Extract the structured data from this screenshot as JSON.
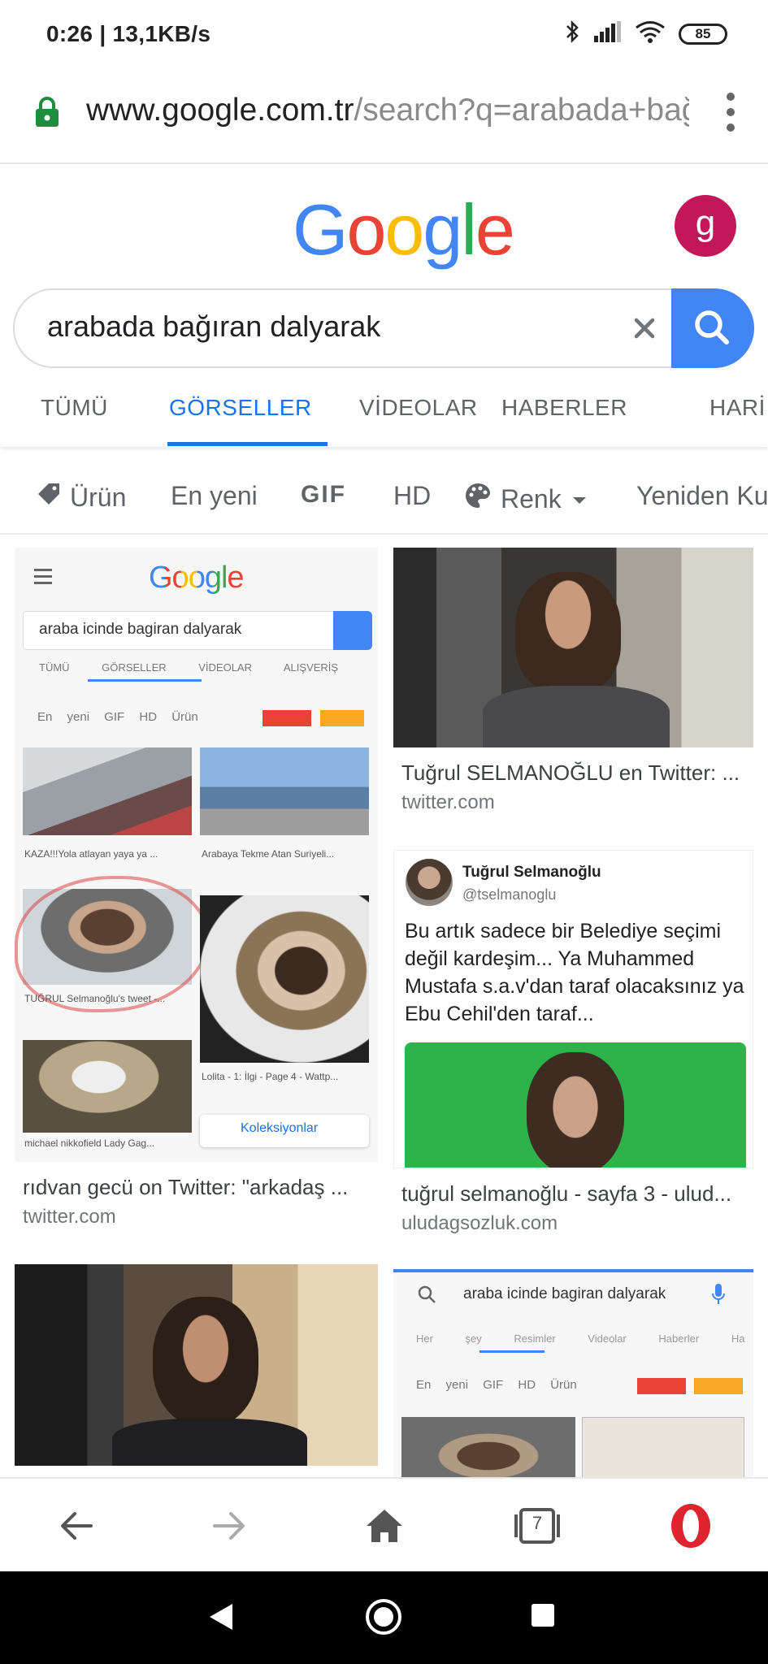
{
  "status_bar": {
    "time_speed": "0:26 | 13,1KB/s",
    "battery": "85"
  },
  "url_bar": {
    "domain": "www.google.com.tr",
    "path": "/search?q=arabada+bağ"
  },
  "header": {
    "logo_letters": [
      "G",
      "o",
      "o",
      "g",
      "l",
      "e"
    ],
    "logo_colors": [
      "#4285F4",
      "#EA4335",
      "#FBBC05",
      "#4285F4",
      "#34A853",
      "#EA4335"
    ],
    "avatar_letter": "g"
  },
  "search": {
    "query": "arabada bağıran dalyarak"
  },
  "tabs": [
    {
      "label": "TÜMÜ"
    },
    {
      "label": "GÖRSELLER"
    },
    {
      "label": "VİDEOLAR"
    },
    {
      "label": "HABERLER"
    },
    {
      "label": "HARİ"
    }
  ],
  "filters": {
    "product": "Ürün",
    "newest": "En yeni",
    "gif": "GIF",
    "hd": "HD",
    "color": "Renk",
    "again": "Yeniden Ku"
  },
  "results": [
    {
      "title": "rıdvan gecü on Twitter: \"arkadaş ...",
      "domain": "twitter.com",
      "mini": {
        "logo": "Google",
        "search_text": "araba icinde bagiran dalyarak",
        "tabs": "TÜMÜ GÖRSELLER VİDEOLAR ALIŞVERİŞ",
        "chips": "En yeni GIF HD Ürün",
        "cap1": "KAZA!!!Yola atlayan yaya ya ...",
        "cap2": "Arabaya Tekme Atan Suriyeli...",
        "cap3": "TUĞRUL Selmanoğlu's tweet -...",
        "cap4": "Lolita - 1: İlgi - Page 4 - Wattp...",
        "cap5": "michael nikkofield Lady Gag...",
        "collections": "Koleksiyonlar"
      }
    },
    {
      "title": "Tuğrul SELMANOĞLU en Twitter: ...",
      "domain": "twitter.com"
    },
    {
      "title": "tuğrul selmanoğlu - sayfa 3 - ulud...",
      "domain": "uludagsozluk.com",
      "tweet": {
        "name": "Tuğrul Selmanoğlu",
        "handle": "@tselmanoglu",
        "body": "Bu artık sadece bir Belediye seçimi değil kardeşim... Ya Muhammed Mustafa s.a.v'dan taraf olacaksınız ya Ebu Cehil'den taraf..."
      }
    },
    {
      "mini": {
        "search_text": "araba icinde bagiran dalyarak",
        "tabs": "Her şey Resimler Videolar Haberler Ha",
        "chips": "En yeni GIF HD Ürün"
      }
    }
  ],
  "bottom_nav": {
    "tab_count": "7"
  }
}
